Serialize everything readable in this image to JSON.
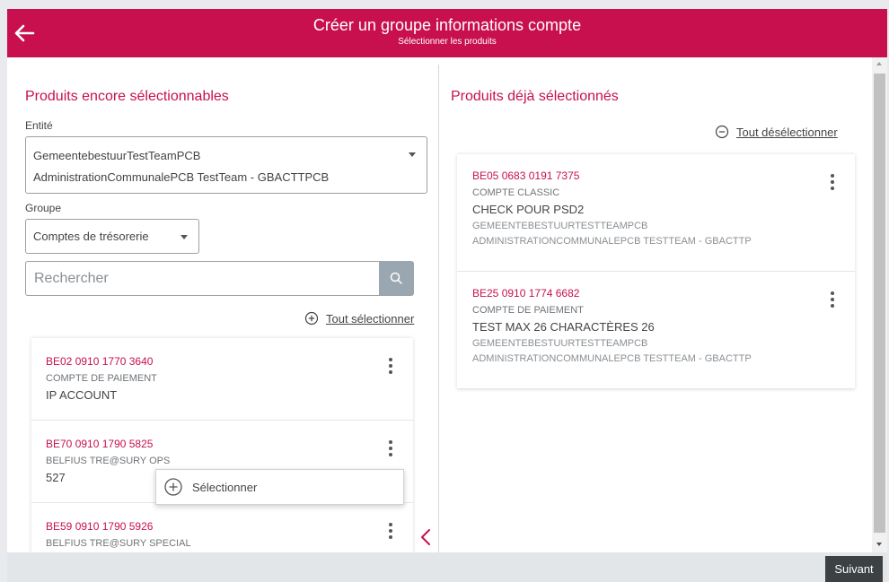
{
  "header": {
    "title": "Créer un groupe informations compte",
    "subtitle": "Sélectionner les produits"
  },
  "left": {
    "title": "Produits encore sélectionnables",
    "entity_label": "Entité",
    "entity_line1": "GemeentebestuurTestTeamPCB",
    "entity_line2": "AdministrationCommunalePCB TestTeam - GBACTTPCB",
    "group_label": "Groupe",
    "group_value": "Comptes de trésorerie",
    "search_placeholder": "Rechercher",
    "select_all": "Tout sélectionner",
    "items": [
      {
        "number": "BE02 0910 1770 3640",
        "type": "COMPTE DE PAIEMENT",
        "name": "IP ACCOUNT"
      },
      {
        "number": "BE70 0910 1790 5825",
        "type": "BELFIUS TRE@SURY OPS",
        "name": "527"
      },
      {
        "number": "BE59 0910 1790 5926",
        "type": "BELFIUS TRE@SURY SPECIAL",
        "name": ""
      }
    ],
    "popup_label": "Sélectionner"
  },
  "right": {
    "title": "Produits déjà sélectionnés",
    "deselect_all": "Tout désélectionner",
    "items": [
      {
        "number": "BE05 0683 0191 7375",
        "type": "COMPTE CLASSIC",
        "name": "CHECK POUR PSD2",
        "entity1": "GEMEENTEBESTUURTESTTEAMPCB",
        "entity2": "ADMINISTRATIONCOMMUNALEPCB TESTTEAM - GBACTTP"
      },
      {
        "number": "BE25 0910 1774 6682",
        "type": "COMPTE DE PAIEMENT",
        "name": "TEST MAX 26 CHARACTÈRES 26",
        "entity1": "GEMEENTEBESTUURTESTTEAMPCB",
        "entity2": "ADMINISTRATIONCOMMUNALEPCB TESTTEAM - GBACTTP"
      }
    ]
  },
  "footer": {
    "next_label": "Suivant"
  },
  "icons": {
    "back": "arrow-left-icon",
    "search": "search-icon",
    "select_all": "plus-circle-icon",
    "deselect_all": "minus-circle-icon",
    "menu": "kebab-icon",
    "move": "chevron-left-icon"
  },
  "colors": {
    "brand": "#c8104f",
    "button": "#3c4144"
  }
}
